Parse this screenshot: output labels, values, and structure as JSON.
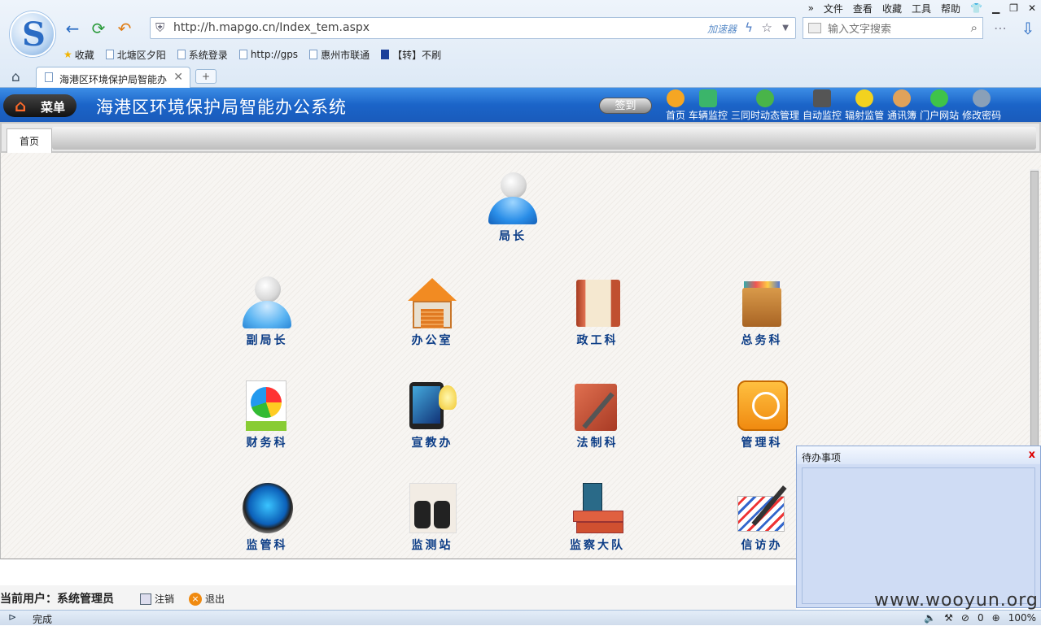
{
  "browser": {
    "top_menu": [
      "»",
      "文件",
      "查看",
      "收藏",
      "工具",
      "帮助"
    ],
    "url": "http://h.mapgo.cn/Index_tem.aspx",
    "accelerator": "加速器",
    "search_placeholder": "输入文字搜索",
    "bookmarks": [
      "收藏",
      "北塘区夕阳",
      "系统登录",
      "http://gps",
      "惠州市联通",
      "【转】不刷"
    ],
    "tab_title": "海港区环境保护局智能办",
    "new_tab": "+"
  },
  "app": {
    "menu_label": "菜单",
    "title": "海港区环境保护局智能办公系统",
    "signin": "签到",
    "nav": [
      {
        "label": "首页",
        "color": "#f5a623"
      },
      {
        "label": "车辆监控",
        "color": "#3bb56a"
      },
      {
        "label": "三同时动态管理",
        "color": "#49b449"
      },
      {
        "label": "自动监控",
        "color": "#555555"
      },
      {
        "label": "辐射监管",
        "color": "#f2d21f"
      },
      {
        "label": "通讯簿",
        "color": "#e0a25a"
      },
      {
        "label": "门户网站",
        "color": "#3fc34a"
      },
      {
        "label": "修改密码",
        "color": "#8aa0b8"
      }
    ],
    "home_tab": "首页"
  },
  "departments": {
    "director": "局长",
    "deputy": "副局长",
    "office": "办公室",
    "politics": "政工科",
    "general": "总务科",
    "finance": "财务科",
    "publicity": "宣教办",
    "legal": "法制科",
    "management": "管理科",
    "supervision": "监管科",
    "monitoring": "监测站",
    "inspection": "监察大队",
    "petition": "信访办"
  },
  "todo": {
    "title": "待办事项",
    "close": "x"
  },
  "user": {
    "current": "当前用户：系统管理员",
    "logout": "注销",
    "exit": "退出"
  },
  "status": {
    "done": "完成",
    "count": "0",
    "zoom": "100%"
  },
  "watermark": "www.wooyun.org"
}
